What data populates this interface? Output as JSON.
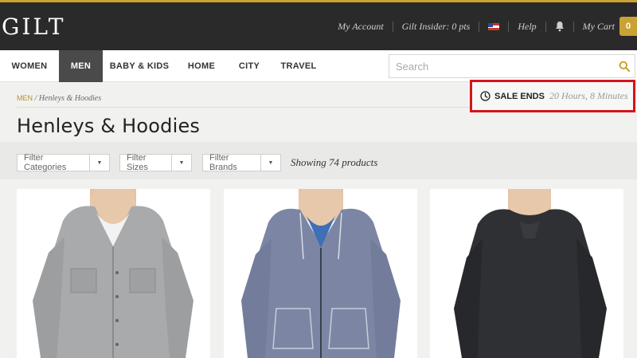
{
  "header": {
    "logo": "GILT",
    "my_account": "My Account",
    "insider": "Gilt Insider: 0 pts",
    "help": "Help",
    "my_cart": "My Cart",
    "cart_count": "0",
    "flag_icon": "us-flag-icon",
    "bell_icon": "bell-icon",
    "accent_color": "#c9a233"
  },
  "nav": {
    "items": [
      {
        "label": "WOMEN",
        "active": false
      },
      {
        "label": "MEN",
        "active": true
      },
      {
        "label": "BABY & KIDS",
        "active": false
      },
      {
        "label": "HOME",
        "active": false
      },
      {
        "label": "CITY",
        "active": false
      },
      {
        "label": "TRAVEL",
        "active": false
      }
    ],
    "search_placeholder": "Search"
  },
  "breadcrumb": {
    "root": "MEN",
    "separator": " / ",
    "current": "Henleys & Hoodies"
  },
  "sale": {
    "label": "SALE ENDS",
    "time": "20 Hours, 8 Minutes",
    "highlight_color": "#d4141b"
  },
  "page": {
    "title": "Henleys & Hoodies"
  },
  "filters": {
    "items": [
      {
        "label": "Filter Categories"
      },
      {
        "label": "Filter Sizes"
      },
      {
        "label": "Filter Brands"
      }
    ],
    "showing": "Showing 74 products"
  },
  "products": [
    {
      "kind": "heather grey button-front hoodie jacket",
      "color": "#a9aaab"
    },
    {
      "kind": "blue-grey zip hoodie",
      "color": "#7c86a4"
    },
    {
      "kind": "charcoal pullover henley hoodie",
      "color": "#2f3034"
    }
  ]
}
